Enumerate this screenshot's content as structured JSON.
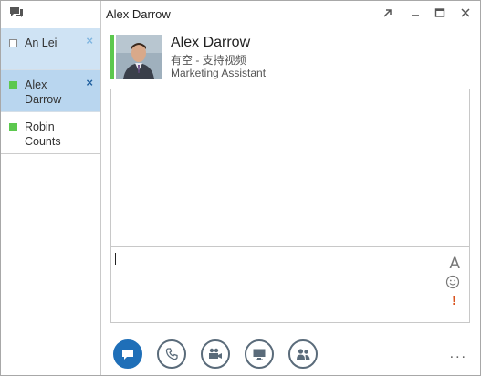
{
  "window": {
    "title": "Alex Darrow"
  },
  "conversations": [
    {
      "name": "An Lei",
      "presence": "offline",
      "closable": true,
      "state": "hover"
    },
    {
      "name": "Alex Darrow",
      "presence": "available",
      "closable": true,
      "state": "active"
    },
    {
      "name": "Robin Counts",
      "presence": "available",
      "closable": false,
      "state": "plain"
    }
  ],
  "contact": {
    "name": "Alex Darrow",
    "status": "有空 - 支持视频",
    "job_title": "Marketing Assistant",
    "presence_color": "#5cc84e"
  },
  "compose": {
    "font_icon_label": "A",
    "importance_label": "!"
  },
  "toolbar": {
    "buttons": [
      "im-icon",
      "phone-icon",
      "video-icon",
      "present-icon",
      "people-icon"
    ],
    "more_label": "..."
  },
  "colors": {
    "accent": "#1f6fb8",
    "available": "#5cc84e",
    "active_item": "#b9d6ef",
    "hover_item": "#cfe3f4"
  },
  "labels": {
    "close_glyph": "×",
    "win_popout": "⇱",
    "win_minimize": "—",
    "win_maximize": "☐",
    "win_close": "✕"
  }
}
